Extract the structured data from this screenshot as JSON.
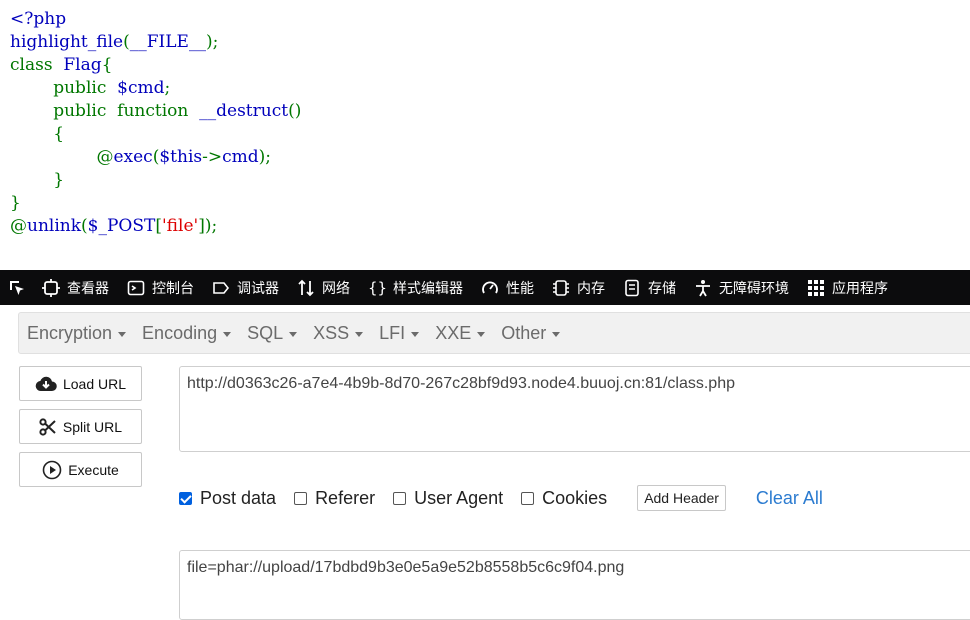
{
  "source_code": {
    "lines": [
      [
        {
          "t": "<?php",
          "c": "dflt"
        }
      ],
      [
        {
          "t": "highlight_file",
          "c": "def"
        },
        {
          "t": "(",
          "c": "kw"
        },
        {
          "t": "__FILE__",
          "c": "def"
        },
        {
          "t": ");",
          "c": "kw"
        }
      ],
      [
        {
          "t": "class ",
          "c": "kw"
        },
        {
          "t": " Flag",
          "c": "def"
        },
        {
          "t": "{",
          "c": "kw"
        }
      ],
      [
        {
          "t": "        public ",
          "c": "kw"
        },
        {
          "t": " $cmd",
          "c": "def"
        },
        {
          "t": ";",
          "c": "kw"
        }
      ],
      [
        {
          "t": "        public ",
          "c": "kw"
        },
        {
          "t": " function ",
          "c": "kw"
        },
        {
          "t": " __destruct",
          "c": "def"
        },
        {
          "t": "()",
          "c": "kw"
        }
      ],
      [
        {
          "t": "        {",
          "c": "kw"
        }
      ],
      [
        {
          "t": "                @",
          "c": "kw"
        },
        {
          "t": "exec",
          "c": "def"
        },
        {
          "t": "(",
          "c": "kw"
        },
        {
          "t": "$this",
          "c": "def"
        },
        {
          "t": "->",
          "c": "kw"
        },
        {
          "t": "cmd",
          "c": "def"
        },
        {
          "t": ");",
          "c": "kw"
        }
      ],
      [
        {
          "t": "        }",
          "c": "kw"
        }
      ],
      [
        {
          "t": "}",
          "c": "kw"
        }
      ],
      [
        {
          "t": "@",
          "c": "kw"
        },
        {
          "t": "unlink",
          "c": "def"
        },
        {
          "t": "(",
          "c": "kw"
        },
        {
          "t": "$_POST",
          "c": "def"
        },
        {
          "t": "[",
          "c": "kw"
        },
        {
          "t": "'file'",
          "c": "str"
        },
        {
          "t": "]);",
          "c": "kw"
        }
      ]
    ]
  },
  "devtools": {
    "tabs": [
      {
        "label": "查看器",
        "icon": "inspector-icon"
      },
      {
        "label": "控制台",
        "icon": "console-icon"
      },
      {
        "label": "调试器",
        "icon": "debugger-icon"
      },
      {
        "label": "网络",
        "icon": "network-icon"
      },
      {
        "label": "样式编辑器",
        "icon": "style-editor-icon"
      },
      {
        "label": "性能",
        "icon": "performance-icon"
      },
      {
        "label": "内存",
        "icon": "memory-icon"
      },
      {
        "label": "存储",
        "icon": "storage-icon"
      },
      {
        "label": "无障碍环境",
        "icon": "accessibility-icon"
      },
      {
        "label": "应用程序",
        "icon": "application-icon"
      }
    ]
  },
  "hackbar": {
    "menu": [
      "Encryption",
      "Encoding",
      "SQL",
      "XSS",
      "LFI",
      "XXE",
      "Other"
    ],
    "load_url": "Load URL",
    "split_url": "Split URL",
    "execute": "Execute",
    "url_value": "http://d0363c26-a7e4-4b9b-8d70-267c28bf9d93.node4.buuoj.cn:81/class.php",
    "post_data_label": "Post data",
    "referer_label": "Referer",
    "user_agent_label": "User Agent",
    "cookies_label": "Cookies",
    "post_data_checked": true,
    "add_header": "Add Header",
    "clear_all": "Clear All",
    "post_body_value": "file=phar://upload/17bdbd9b3e0e5a9e52b8558b5c6c9f04.png"
  }
}
